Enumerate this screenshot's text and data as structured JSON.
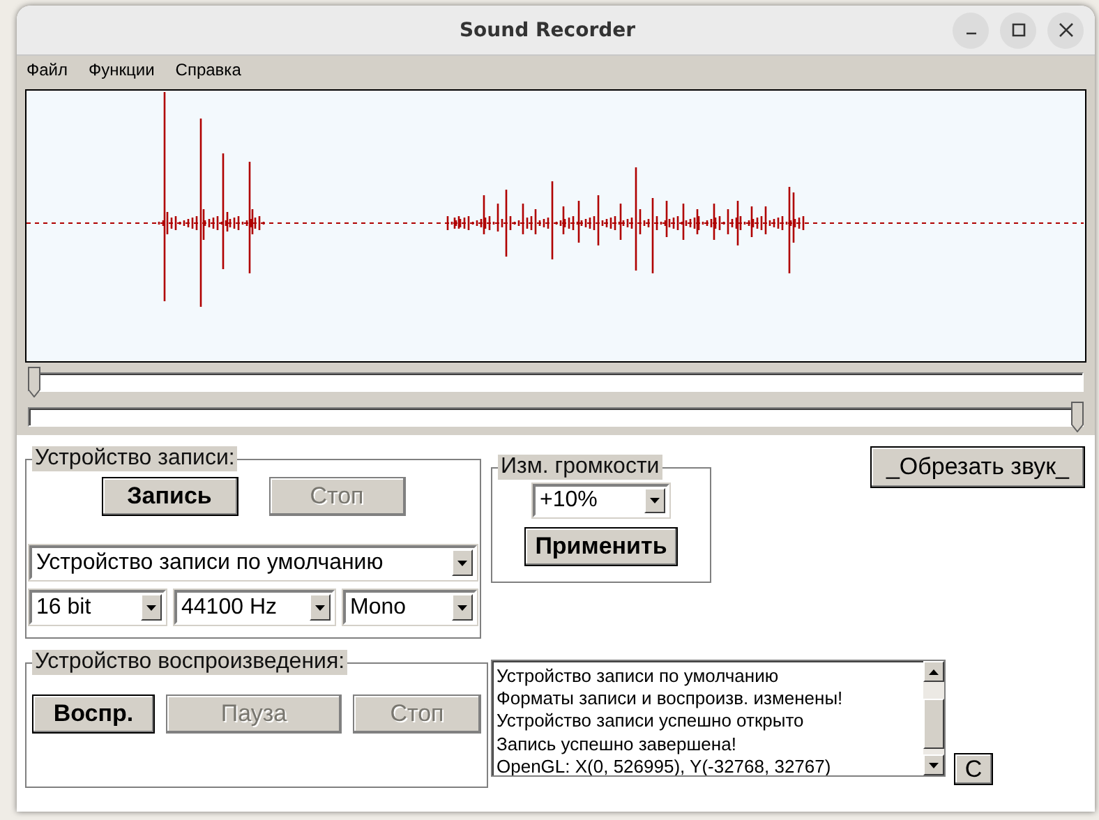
{
  "window": {
    "title": "Sound Recorder"
  },
  "menu": [
    {
      "label": "Файл"
    },
    {
      "label": "Функции"
    },
    {
      "label": "Справка"
    }
  ],
  "position_slider": {
    "level": 0
  },
  "range_slider": {
    "level": 1
  },
  "recording": {
    "title": "Устройство записи:",
    "buttons": [
      {
        "label": "Запись",
        "disabled": false
      },
      {
        "label": "Стоп",
        "disabled": true
      }
    ],
    "device": "Устройство записи по умолчанию",
    "bits": "16 bit",
    "rate": "44100 Hz",
    "channels": "Mono"
  },
  "volume": {
    "title": "Изм. громкости",
    "value": "+10%",
    "button": "Применить"
  },
  "trim_button": "_Обрезать звук_",
  "playback": {
    "title": "Устройство воспроизведения:",
    "buttons": [
      {
        "label": "Воспр.",
        "disabled": false
      },
      {
        "label": "Пауза",
        "disabled": true
      },
      {
        "label": "Стоп",
        "disabled": true
      }
    ]
  },
  "log": {
    "lines": [
      "Устройство записи по умолчанию",
      "Форматы записи и воспроизв. изменены!",
      "Устройство записи успешно открыто",
      "Запись успешно завершена!",
      "OpenGL: X(0, 526995), Y(-32768, 32767)"
    ]
  },
  "clear_button": "C"
}
